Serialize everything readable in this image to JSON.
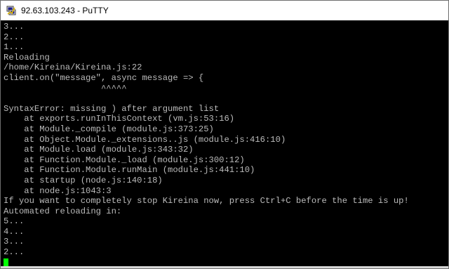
{
  "window": {
    "title": "92.63.103.243 - PuTTY",
    "icon": "putty-icon"
  },
  "terminal": {
    "lines": [
      "3...",
      "2...",
      "1...",
      "Reloading",
      "/home/Kireina/Kireina.js:22",
      "client.on(\"message\", async message => {",
      "                   ^^^^^",
      "",
      "SyntaxError: missing ) after argument list",
      "    at exports.runInThisContext (vm.js:53:16)",
      "    at Module._compile (module.js:373:25)",
      "    at Object.Module._extensions..js (module.js:416:10)",
      "    at Module.load (module.js:343:32)",
      "    at Function.Module._load (module.js:300:12)",
      "    at Function.Module.runMain (module.js:441:10)",
      "    at startup (node.js:140:18)",
      "    at node.js:1043:3",
      "If you want to completely stop Kireina now, press Ctrl+C before the time is up!",
      "Automated reloading in:",
      "5...",
      "4...",
      "3...",
      "2..."
    ],
    "cursor_color": "#00ff00",
    "text_color": "#bbbbbb",
    "background_color": "#000000"
  }
}
